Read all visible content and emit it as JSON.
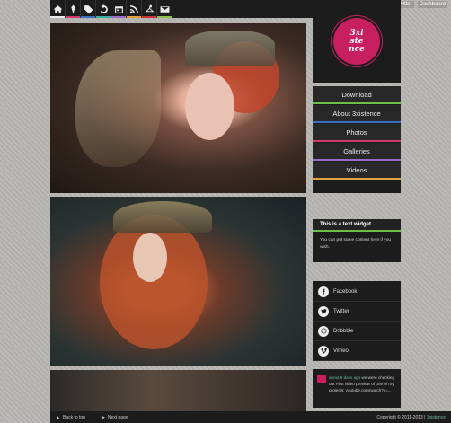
{
  "topbar": {
    "icons": [
      "home-icon",
      "pin-icon",
      "tag-icon",
      "refresh-icon",
      "calendar-icon",
      "rss-icon",
      "hanger-icon",
      "mail-icon"
    ],
    "social_top": [
      "Twitter",
      "Dashboard"
    ]
  },
  "logo": {
    "line1": "3xi",
    "line2": "ste",
    "line3": "nce"
  },
  "nav": [
    {
      "label": "Download",
      "color": "#6cc04a"
    },
    {
      "label": "About 3xistence",
      "color": "#3b6fc4"
    },
    {
      "label": "Photos",
      "color": "#d23a6b"
    },
    {
      "label": "Galleries",
      "color": "#9a6bc9"
    },
    {
      "label": "Videos",
      "color": "#e2a13c"
    }
  ],
  "widget": {
    "title": "This is a text widget",
    "body": "You can put some content here if you wish."
  },
  "social": [
    {
      "label": "Facebook",
      "icon": "facebook-icon"
    },
    {
      "label": "Twitter",
      "icon": "twitter-icon"
    },
    {
      "label": "Dribbble",
      "icon": "dribbble-icon"
    },
    {
      "label": "Vimeo",
      "icon": "vimeo-icon"
    }
  ],
  "tweet": {
    "link": "about 5 days ago",
    "text": " we were checking out First video preview of one of my projects: youtube.com/watch?v=..."
  },
  "footer": {
    "back_to_top": "Back to top",
    "next_page": "Next page",
    "copyright": "Copyright © 2011-2013 |",
    "brand": "3xistence"
  }
}
